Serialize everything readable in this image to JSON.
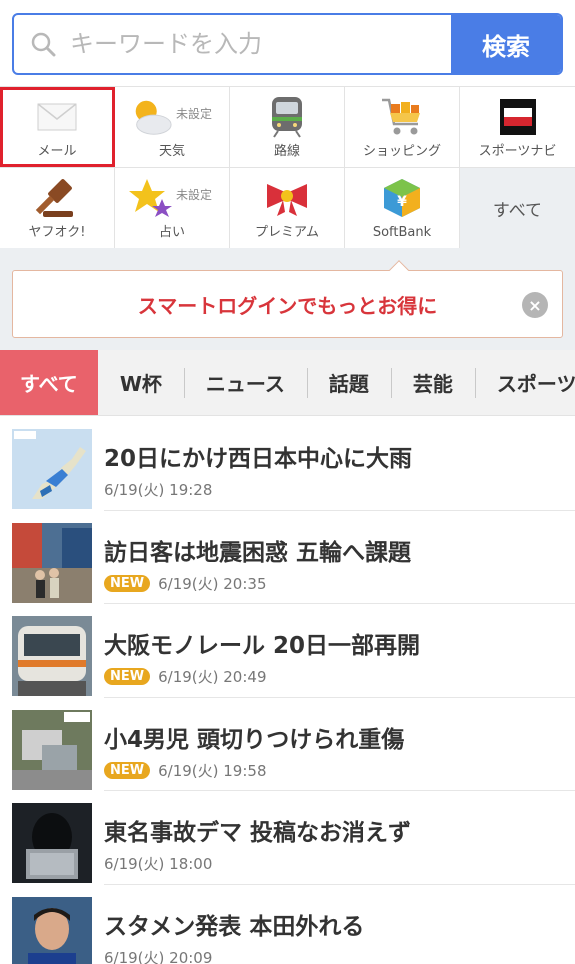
{
  "search": {
    "placeholder": "キーワードを入力",
    "button_label": "検索"
  },
  "services": {
    "row1": [
      {
        "label": "メール",
        "icon": "mail-icon",
        "selected": true
      },
      {
        "label": "天気",
        "icon": "weather-icon",
        "status": "未設定"
      },
      {
        "label": "路線",
        "icon": "train-icon"
      },
      {
        "label": "ショッピング",
        "icon": "shopping-cart-icon"
      },
      {
        "label": "スポーツナビ",
        "icon": "sportsnavi-logo-icon"
      }
    ],
    "row2": [
      {
        "label": "ヤフオク!",
        "icon": "auction-gavel-icon"
      },
      {
        "label": "占い",
        "icon": "fortune-stars-icon",
        "status": "未設定"
      },
      {
        "label": "プレミアム",
        "icon": "premium-ribbon-icon"
      },
      {
        "label": "SoftBank",
        "icon": "softbank-icon"
      },
      {
        "label": "すべて"
      }
    ]
  },
  "login_banner": {
    "text": "スマートログインでもっとお得に",
    "close": "×"
  },
  "tabs": [
    "すべて",
    "W杯",
    "ニュース",
    "話題",
    "芸能",
    "スポーツ"
  ],
  "news": [
    {
      "title": "20日にかけ西日本中心に大雨",
      "date": "6/19(火) 19:28",
      "new": false,
      "thumb": "weather-map-thumbnail"
    },
    {
      "title": "訪日客は地震困惑 五輪へ課題",
      "date": "6/19(火) 20:35",
      "new": true,
      "badge": "NEW",
      "thumb": "tourists-thumbnail"
    },
    {
      "title": "大阪モノレール 20日一部再開",
      "date": "6/19(火) 20:49",
      "new": true,
      "badge": "NEW",
      "thumb": "monorail-thumbnail"
    },
    {
      "title": "小4男児 頭切りつけられ重傷",
      "date": "6/19(火) 19:58",
      "new": true,
      "badge": "NEW",
      "thumb": "aerial-scene-thumbnail"
    },
    {
      "title": "東名事故デマ 投稿なお消えず",
      "date": "6/19(火) 18:00",
      "new": false,
      "thumb": "hacker-thumbnail"
    },
    {
      "title": "スタメン発表 本田外れる",
      "date": "6/19(火) 20:09",
      "new": false,
      "thumb": "soccer-player-thumbnail"
    }
  ],
  "colors": {
    "accent_blue": "#4a7de6",
    "selected_red": "#e0212d",
    "active_tab": "#e9626b",
    "login_text": "#d8353b",
    "new_badge": "#e8a71f"
  }
}
